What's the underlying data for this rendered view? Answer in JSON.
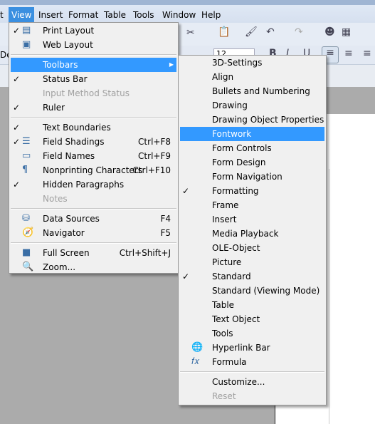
{
  "menubar": {
    "items": [
      "t",
      "View",
      "Insert",
      "Format",
      "Table",
      "Tools",
      "Window",
      "Help"
    ],
    "active": "View"
  },
  "toolbar": {
    "font_name_partial": "De",
    "font_size": "12",
    "bold": "B",
    "italic": "I",
    "underline": "U"
  },
  "view_menu": {
    "items": [
      {
        "label": "Print Layout",
        "checked": true,
        "icon": "print-layout-icon"
      },
      {
        "label": "Web Layout",
        "icon": "web-layout-icon"
      },
      {
        "sep": true
      },
      {
        "label": "Toolbars",
        "submenu": true,
        "highlighted": true
      },
      {
        "label": "Status Bar",
        "checked": true
      },
      {
        "label": "Input Method Status",
        "disabled": true
      },
      {
        "label": "Ruler",
        "checked": true
      },
      {
        "sep": true
      },
      {
        "label": "Text Boundaries",
        "checked": true
      },
      {
        "label": "Field Shadings",
        "checked": true,
        "shortcut": "Ctrl+F8",
        "icon": "field-shadings-icon"
      },
      {
        "label": "Field Names",
        "shortcut": "Ctrl+F9",
        "icon": "field-names-icon"
      },
      {
        "label": "Nonprinting Characters",
        "shortcut": "Ctrl+F10",
        "icon": "pilcrow-icon"
      },
      {
        "label": "Hidden Paragraphs",
        "checked": true
      },
      {
        "label": "Notes",
        "disabled": true
      },
      {
        "sep": true
      },
      {
        "label": "Data Sources",
        "shortcut": "F4",
        "icon": "database-icon"
      },
      {
        "label": "Navigator",
        "shortcut": "F5",
        "icon": "compass-icon"
      },
      {
        "sep": true
      },
      {
        "label": "Full Screen",
        "shortcut": "Ctrl+Shift+J",
        "icon": "full-screen-icon"
      },
      {
        "label": "Zoom...",
        "icon": "zoom-icon"
      }
    ]
  },
  "toolbars_submenu": {
    "items": [
      {
        "label": "3D-Settings"
      },
      {
        "label": "Align"
      },
      {
        "label": "Bullets and Numbering"
      },
      {
        "label": "Drawing"
      },
      {
        "label": "Drawing Object Properties"
      },
      {
        "label": "Fontwork",
        "highlighted": true
      },
      {
        "label": "Form Controls"
      },
      {
        "label": "Form Design"
      },
      {
        "label": "Form Navigation"
      },
      {
        "label": "Formatting",
        "checked": true
      },
      {
        "label": "Frame"
      },
      {
        "label": "Insert"
      },
      {
        "label": "Media Playback"
      },
      {
        "label": "OLE-Object"
      },
      {
        "label": "Picture"
      },
      {
        "label": "Standard",
        "checked": true
      },
      {
        "label": "Standard (Viewing Mode)"
      },
      {
        "label": "Table"
      },
      {
        "label": "Text Object"
      },
      {
        "label": "Tools"
      },
      {
        "label": "Hyperlink Bar",
        "icon": "hyperlink-icon"
      },
      {
        "label": "Formula",
        "icon": "formula-icon"
      },
      {
        "sep": true
      },
      {
        "label": "Customize..."
      },
      {
        "label": "Reset",
        "disabled": true
      }
    ]
  },
  "colors": {
    "highlight": "#3399ff",
    "menubar_active": "#3a8fe0",
    "menu_bg": "#f0f0f0",
    "disabled": "#a0a0a0"
  }
}
